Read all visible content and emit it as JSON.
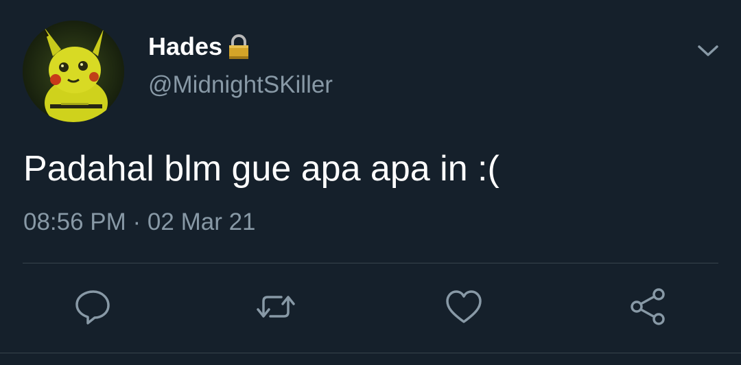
{
  "author": {
    "display_name": "Hades",
    "handle": "@MidnightSKiller",
    "protected_icon": "lock-icon",
    "avatar": "pikachu-avatar"
  },
  "tweet": {
    "text": "Padahal blm gue apa apa in :(",
    "timestamp": "08:56 PM · 02 Mar 21"
  },
  "menu_icon": "chevron-down-icon",
  "actions": [
    "reply-icon",
    "retweet-icon",
    "like-icon",
    "share-icon"
  ],
  "colors": {
    "background": "#15202b",
    "text_primary": "#ffffff",
    "text_secondary": "#8899a6",
    "divider": "#38444d"
  }
}
